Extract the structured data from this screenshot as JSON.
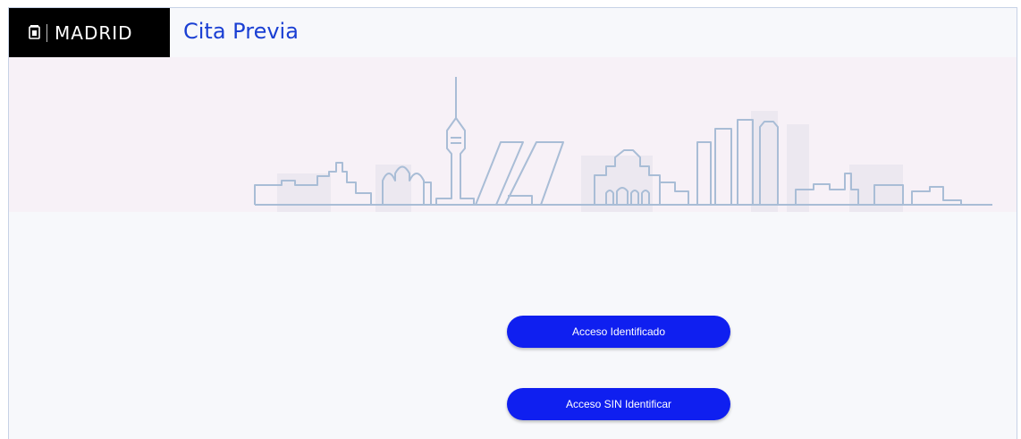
{
  "header": {
    "logo_text": "MADRID",
    "app_title": "Cita Previa"
  },
  "icons": {
    "crest": "madrid-crest-icon",
    "skyline": "madrid-skyline-illustration"
  },
  "actions": {
    "acceso_identificado": "Acceso Identificado",
    "acceso_sin_identificar": "Acceso SIN Identificar"
  },
  "colors": {
    "brand_blue": "#0f1ff0",
    "title_blue": "#1a3fd3",
    "logo_bg": "#000000",
    "skyline_stroke": "#a9bdd6",
    "band_bg": "#f7f1f7"
  }
}
